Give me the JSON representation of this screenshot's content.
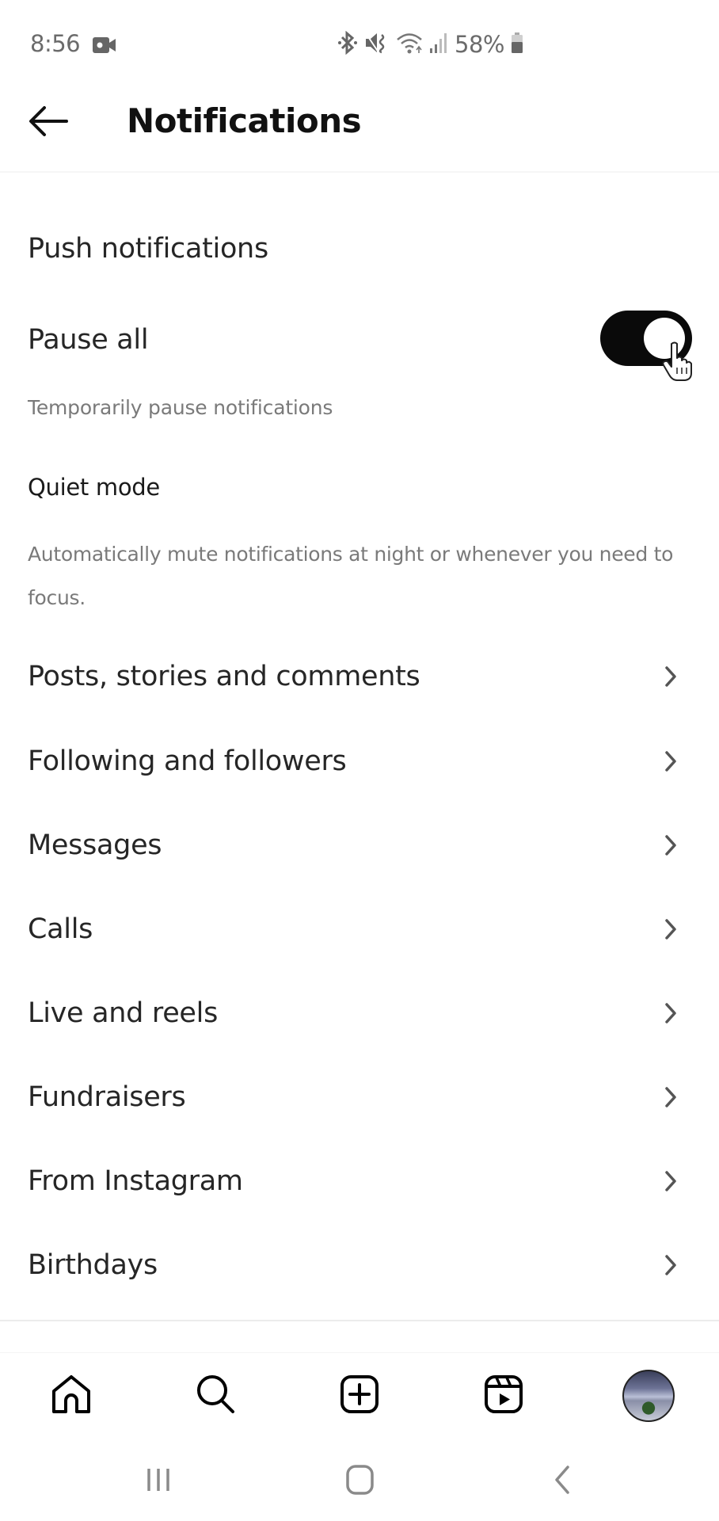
{
  "status_bar": {
    "time": "8:56",
    "battery_percent": "58%",
    "icons": [
      "video-record-icon",
      "bluetooth-icon",
      "mute-vibrate-icon",
      "wifi-icon",
      "signal-icon",
      "battery-icon"
    ]
  },
  "header": {
    "back_icon": "arrow-left-icon",
    "title": "Notifications"
  },
  "push_section": {
    "title": "Push notifications",
    "pause_all": {
      "label": "Pause all",
      "enabled": true,
      "description": "Temporarily pause notifications"
    },
    "quiet_mode": {
      "label": "Quiet mode",
      "description": "Automatically mute notifications at night or whenever you need to focus."
    }
  },
  "rows": [
    {
      "label": "Posts, stories and comments"
    },
    {
      "label": "Following and followers"
    },
    {
      "label": "Messages"
    },
    {
      "label": "Calls"
    },
    {
      "label": "Live and reels"
    },
    {
      "label": "Fundraisers"
    },
    {
      "label": "From Instagram"
    },
    {
      "label": "Birthdays"
    }
  ],
  "colors": {
    "toggle_on": "#0a0a0a",
    "text_primary": "#262626",
    "text_secondary": "#7a7a7a"
  },
  "tab_bar": {
    "tabs": [
      "home-icon",
      "search-icon",
      "create-post-icon",
      "reels-icon",
      "profile-avatar"
    ]
  },
  "system_nav": {
    "buttons": [
      "recent-apps",
      "home",
      "back"
    ]
  }
}
